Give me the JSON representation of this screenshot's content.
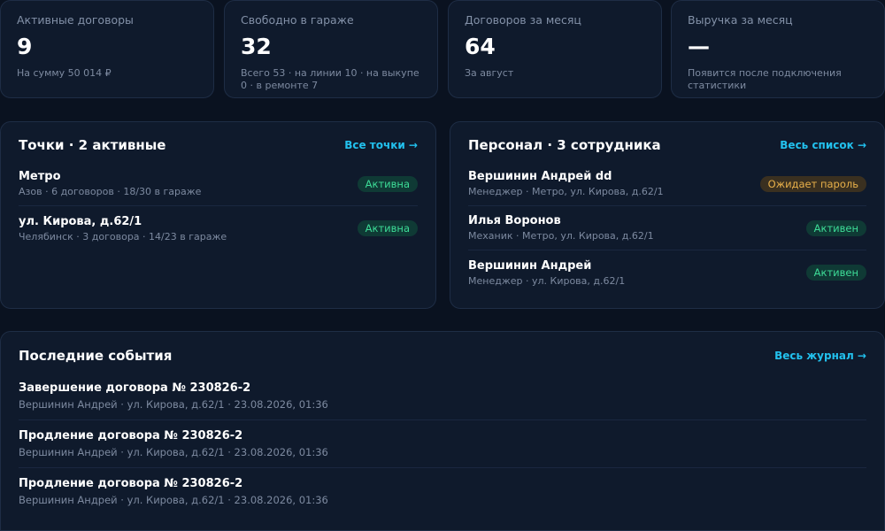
{
  "stats": [
    {
      "label": "Активные договоры",
      "value": "9",
      "sub": "На сумму 50 014 ₽"
    },
    {
      "label": "Свободно в гараже",
      "value": "32",
      "sub": "Всего 53 · на линии 10 · на выкупе 0 · в ремонте 7"
    },
    {
      "label": "Договоров за месяц",
      "value": "64",
      "sub": "За август"
    },
    {
      "label": "Выручка за месяц",
      "value": "—",
      "sub": "Появится после подключения статистики"
    }
  ],
  "points": {
    "title": "Точки · 2 активные",
    "link": "Все точки →",
    "items": [
      {
        "name": "Метро",
        "sub": "Азов · 6 договоров · 18/30 в гараже",
        "status": "Активна"
      },
      {
        "name": "ул. Кирова, д.62/1",
        "sub": "Челябинск · 3 договора · 14/23 в гараже",
        "status": "Активна"
      }
    ]
  },
  "staff": {
    "title": "Персонал · 3 сотрудника",
    "link": "Весь список →",
    "items": [
      {
        "name": "Вершинин Андрей dd",
        "sub": "Менеджер · Метро, ул. Кирова, д.62/1",
        "status": "Ожидает пароль"
      },
      {
        "name": "Илья Воронов",
        "sub": "Механик · Метро, ул. Кирова, д.62/1",
        "status": "Активен"
      },
      {
        "name": "Вершинин Андрей",
        "sub": "Менеджер · ул. Кирова, д.62/1",
        "status": "Активен"
      }
    ]
  },
  "events": {
    "title": "Последние события",
    "link": "Весь журнал →",
    "items": [
      {
        "title": "Завершение договора № 230826-2",
        "sub": "Вершинин Андрей · ул. Кирова, д.62/1 · 23.08.2026, 01:36"
      },
      {
        "title": "Продление договора № 230826-2",
        "sub": "Вершинин Андрей · ул. Кирова, д.62/1 · 23.08.2026, 01:36"
      },
      {
        "title": "Продление договора № 230826-2",
        "sub": "Вершинин Андрей · ул. Кирова, д.62/1 · 23.08.2026, 01:36"
      }
    ]
  }
}
